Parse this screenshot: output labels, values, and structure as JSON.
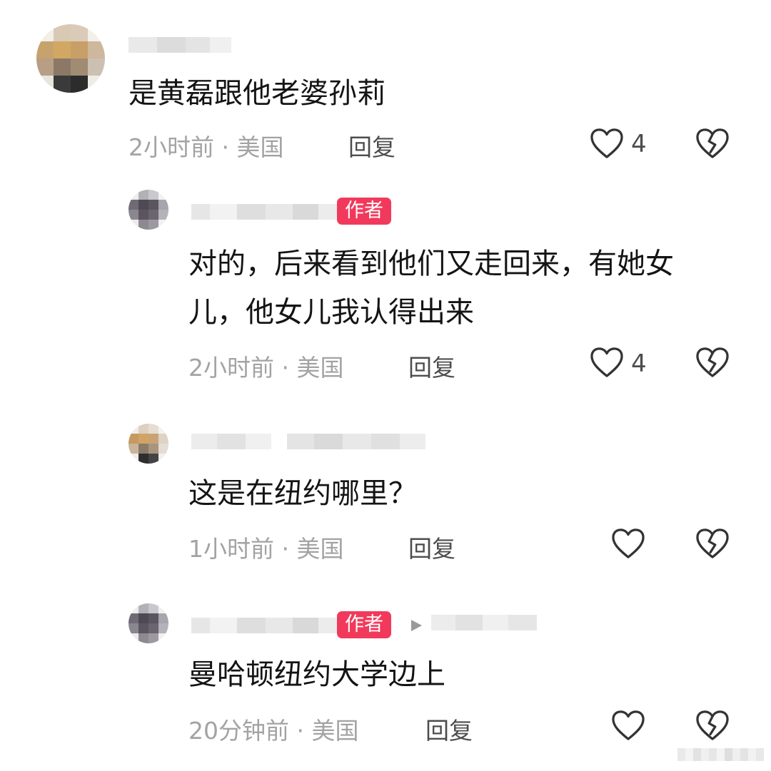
{
  "comments": [
    {
      "text": "是黄磊跟他老婆孙莉",
      "meta": "2小时前 · 美国",
      "reply_label": "回复",
      "likes": "4"
    },
    {
      "badge": "作者",
      "text_line1": "对的，后来看到他们又走回来，有她女",
      "text_line2": "儿，他女儿我认得出来",
      "meta": "2小时前 · 美国",
      "reply_label": "回复",
      "likes": "4"
    },
    {
      "text": "这是在纽约哪里？",
      "meta": "1小时前 · 美国",
      "reply_label": "回复"
    },
    {
      "badge": "作者",
      "text": "曼哈顿纽约大学边上",
      "meta": "20分钟前 · 美国",
      "reply_label": "回复"
    }
  ],
  "icons": {
    "like": "heart-outline-icon",
    "dislike": "broken-heart-icon",
    "reply_to": "triangle-right-icon"
  },
  "colors": {
    "author_badge": "#f13a5b",
    "meta_text": "#a3a3a3",
    "body_text": "#141414"
  }
}
